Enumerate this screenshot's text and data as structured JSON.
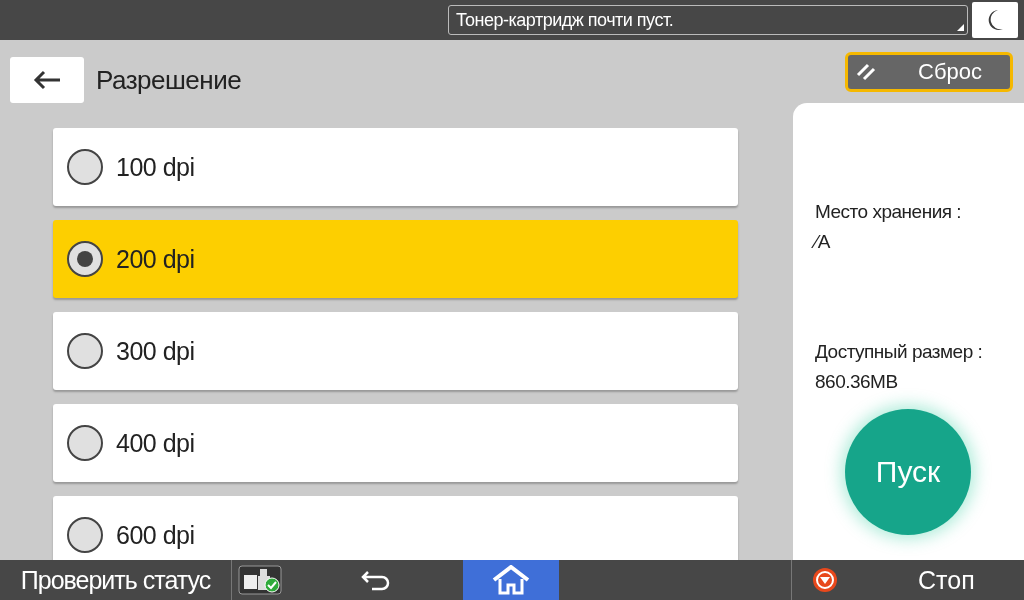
{
  "notification": {
    "message": "Тонер-картридж почти пуст."
  },
  "header": {
    "title": "Разрешение",
    "reset_label": "Сброс"
  },
  "options": [
    {
      "label": "100 dpi",
      "selected": false
    },
    {
      "label": "200 dpi",
      "selected": true
    },
    {
      "label": "300 dpi",
      "selected": false
    },
    {
      "label": "400 dpi",
      "selected": false
    },
    {
      "label": "600 dpi",
      "selected": false
    }
  ],
  "info": {
    "storage_label": "Место хранения :",
    "storage_value": "⁄A",
    "size_label": "Доступный размер :",
    "size_value": "860.36MB",
    "start_label": "Пуск"
  },
  "bottom_bar": {
    "status_label": "Проверить статус",
    "stop_label": "Стоп"
  }
}
